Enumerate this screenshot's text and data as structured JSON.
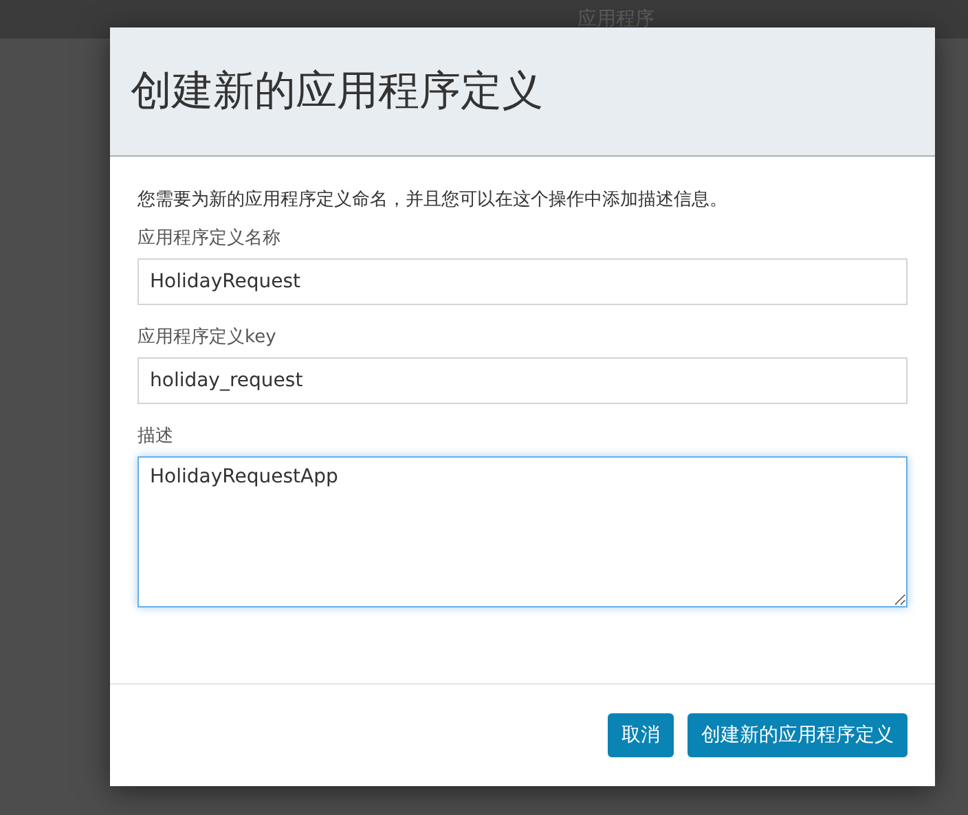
{
  "nav": {
    "items": [
      "应用程序"
    ]
  },
  "dialog": {
    "title": "创建新的应用程序定义",
    "intro": "您需要为新的应用程序定义命名，并且您可以在这个操作中添加描述信息。",
    "fields": [
      {
        "kind": "input",
        "label": "应用程序定义名称",
        "value": "HolidayRequest",
        "focused": false
      },
      {
        "kind": "input",
        "label": "应用程序定义key",
        "value": "holiday_request",
        "focused": false
      },
      {
        "kind": "textarea",
        "label": "描述",
        "value": "HolidayRequestApp",
        "focused": true
      }
    ],
    "buttons": [
      "取消",
      "创建新的应用程序定义"
    ]
  }
}
